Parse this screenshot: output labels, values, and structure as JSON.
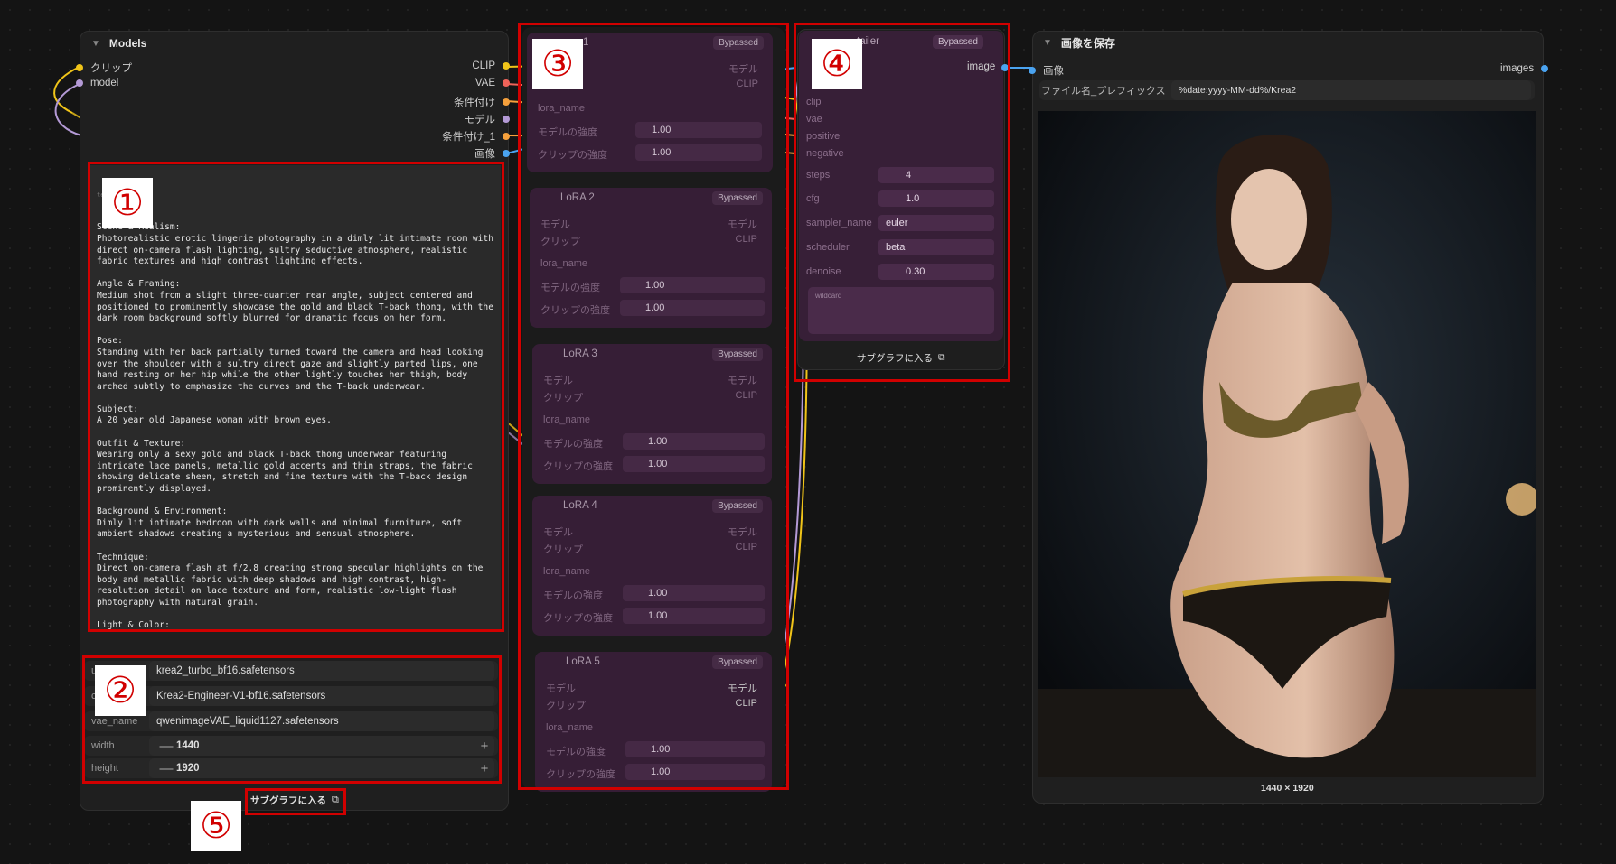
{
  "models_node": {
    "title": "Models",
    "inputs": [
      {
        "label": "クリップ",
        "color": "#f0c419"
      },
      {
        "label": "model",
        "color": "#b49ad6"
      }
    ],
    "outputs": [
      {
        "label": "CLIP",
        "color": "#f0c419"
      },
      {
        "label": "VAE",
        "color": "#f0645a"
      },
      {
        "label": "条件付け",
        "color": "#f5a03c"
      },
      {
        "label": "モデル",
        "color": "#b49ad6"
      },
      {
        "label": "条件付け_1",
        "color": "#f5a03c"
      },
      {
        "label": "画像",
        "color": "#4aa3f0"
      }
    ],
    "prompt_label": "text",
    "prompt_text": "Scene & Realism:\nPhotorealistic erotic lingerie photography in a dimly lit intimate room with direct on-camera flash lighting, sultry seductive atmosphere, realistic fabric textures and high contrast lighting effects.\n\nAngle & Framing:\nMedium shot from a slight three-quarter rear angle, subject centered and positioned to prominently showcase the gold and black T-back thong, with the dark room background softly blurred for dramatic focus on her form.\n\nPose:\nStanding with her back partially turned toward the camera and head looking over the shoulder with a sultry direct gaze and slightly parted lips, one hand resting on her hip while the other lightly touches her thigh, body arched subtly to emphasize the curves and the T-back underwear.\n\nSubject:\nA 20 year old Japanese woman with brown eyes.\n\nOutfit & Texture:\nWearing only a sexy gold and black T-back thong underwear featuring intricate lace panels, metallic gold accents and thin straps, the fabric showing delicate sheen, stretch and fine texture with the T-back design prominently displayed.\n\nBackground & Environment:\nDimly lit intimate bedroom with dark walls and minimal furniture, soft ambient shadows creating a mysterious and sensual atmosphere.\n\nTechnique:\nDirect on-camera flash at f/2.8 creating strong specular highlights on the body and metallic fabric with deep shadows and high contrast, high-resolution detail on lace texture and form, realistic low-light flash photography with natural grain.\n\nLight & Color:\nDirect harsh flash lighting against the dark room creating dramatic high contrast with bright highlights on the gold accents and skin and deep moody shadows, low-key sultry color palette with rich golds, blacks and warm skin tones contrasting the cool dark background.",
    "widgets": [
      {
        "label": "u",
        "value": "krea2_turbo_bf16.safetensors"
      },
      {
        "label": "c",
        "value": "Krea2-Engineer-V1-bf16.safetensors"
      },
      {
        "label": "vae_name",
        "value": "qwenimageVAE_liquid1127.safetensors"
      }
    ],
    "width": {
      "label": "width",
      "value": "1440"
    },
    "height": {
      "label": "height",
      "value": "1920"
    },
    "enter_subgraph": "サブグラフに入る"
  },
  "lora_nodes": [
    {
      "title": "1",
      "bypassed": "Bypassed",
      "model_in": "モデル",
      "clip_in": "クリップ",
      "model_out": "モデル",
      "clip_out": "CLIP",
      "lora_label": "lora_name",
      "model_strength_label": "モデルの強度",
      "model_strength": "1.00",
      "clip_strength_label": "クリップの強度",
      "clip_strength": "1.00"
    },
    {
      "title": "LoRA 2",
      "bypassed": "Bypassed",
      "model_in": "モデル",
      "clip_in": "クリップ",
      "model_out": "モデル",
      "clip_out": "CLIP",
      "lora_label": "lora_name",
      "model_strength_label": "モデルの強度",
      "model_strength": "1.00",
      "clip_strength_label": "クリップの強度",
      "clip_strength": "1.00"
    },
    {
      "title": "LoRA 3",
      "bypassed": "Bypassed",
      "model_in": "モデル",
      "clip_in": "クリップ",
      "model_out": "モデル",
      "clip_out": "CLIP",
      "lora_label": "lora_name",
      "model_strength_label": "モデルの強度",
      "model_strength": "1.00",
      "clip_strength_label": "クリップの強度",
      "clip_strength": "1.00"
    },
    {
      "title": "LoRA 4",
      "bypassed": "Bypassed",
      "model_in": "モデル",
      "clip_in": "クリップ",
      "model_out": "モデル",
      "clip_out": "CLIP",
      "lora_label": "lora_name",
      "model_strength_label": "モデルの強度",
      "model_strength": "1.00",
      "clip_strength_label": "クリップの強度",
      "clip_strength": "1.00"
    },
    {
      "title": "LoRA 5",
      "bypassed": "Bypassed",
      "model_in": "モデル",
      "clip_in": "クリップ",
      "model_out": "モデル",
      "clip_out": "CLIP",
      "lora_label": "lora_name",
      "model_strength_label": "モデルの強度",
      "model_strength": "1.00",
      "clip_strength_label": "クリップの強度",
      "clip_strength": "1.00"
    }
  ],
  "detailer_node": {
    "title": "tailer",
    "bypassed": "Bypassed",
    "output": "image",
    "inputs": [
      "clip",
      "vae",
      "positive",
      "negative"
    ],
    "steps": {
      "label": "steps",
      "value": "4"
    },
    "cfg": {
      "label": "cfg",
      "value": "1.0"
    },
    "sampler_name": {
      "label": "sampler_name",
      "value": "euler"
    },
    "scheduler": {
      "label": "scheduler",
      "value": "beta"
    },
    "denoise": {
      "label": "denoise",
      "value": "0.30"
    },
    "wildcard": "wildcard",
    "enter_subgraph": "サブグラフに入る"
  },
  "save_node": {
    "title": "画像を保存",
    "input": "画像",
    "output": "images",
    "prefix_label": "ファイル名_プレフィックス",
    "prefix_value": "%date:yyyy-MM-dd%/Krea2",
    "dimensions": "1440 × 1920"
  },
  "badges": [
    "①",
    "②",
    "③",
    "④",
    "⑤"
  ],
  "colors": {
    "clip": "#f0c419",
    "model": "#b49ad6",
    "vae": "#f0645a",
    "conditioning": "#f5a03c",
    "image": "#4aa3f0",
    "annotation": "#d10000"
  }
}
